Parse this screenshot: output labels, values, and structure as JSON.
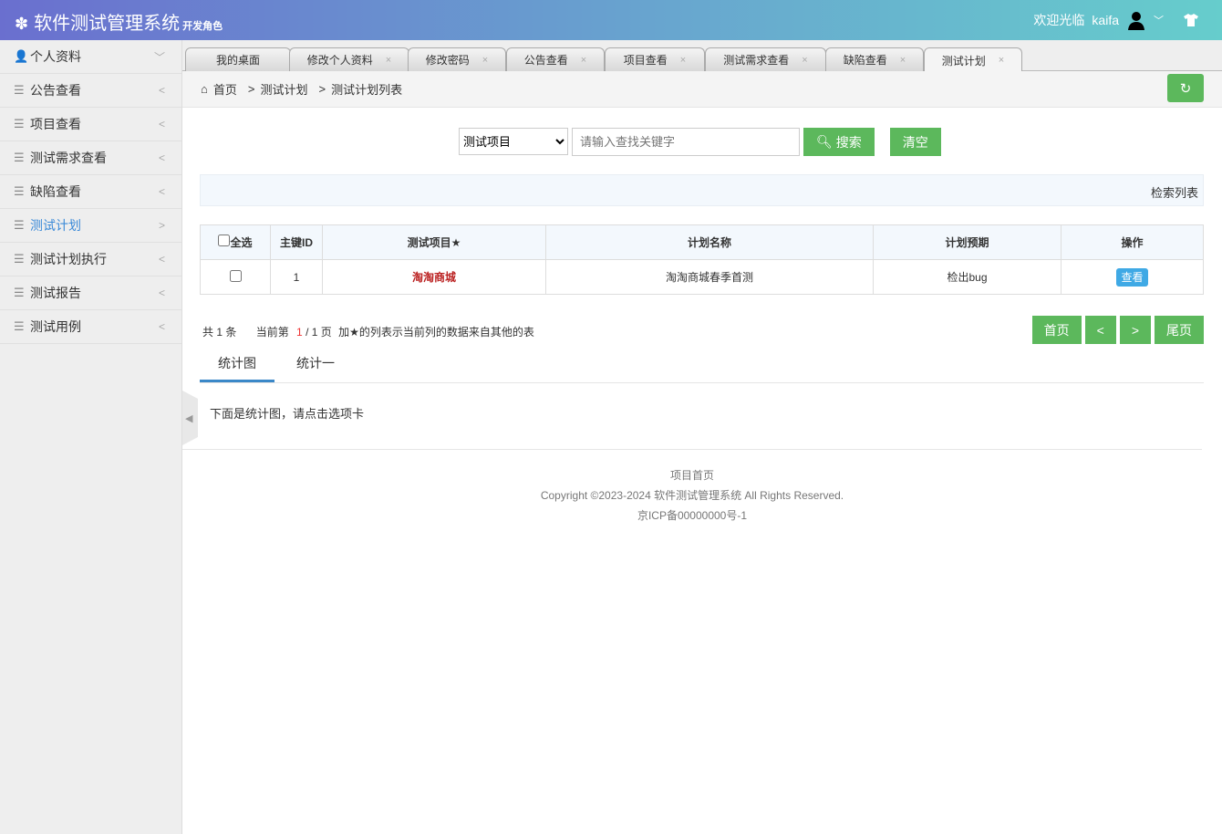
{
  "header": {
    "title": "软件测试管理系统",
    "role": "开发角色",
    "welcome": "欢迎光临",
    "user": "kaifa"
  },
  "sidebar": {
    "items": [
      {
        "label": "个人资料",
        "arrow": "﹀"
      },
      {
        "label": "公告查看",
        "arrow": "<"
      },
      {
        "label": "项目查看",
        "arrow": "<"
      },
      {
        "label": "测试需求查看",
        "arrow": "<"
      },
      {
        "label": "缺陷查看",
        "arrow": "<"
      },
      {
        "label": "测试计划",
        "arrow": ">"
      },
      {
        "label": "测试计划执行",
        "arrow": "<"
      },
      {
        "label": "测试报告",
        "arrow": "<"
      },
      {
        "label": "测试用例",
        "arrow": "<"
      }
    ]
  },
  "tabs": [
    {
      "label": "我的桌面"
    },
    {
      "label": "修改个人资料"
    },
    {
      "label": "修改密码"
    },
    {
      "label": "公告查看"
    },
    {
      "label": "项目查看"
    },
    {
      "label": "测试需求查看"
    },
    {
      "label": "缺陷查看"
    },
    {
      "label": "测试计划"
    }
  ],
  "tab_close": "×",
  "breadcrumb": {
    "home": "首页",
    "sep": ">",
    "level1": "测试计划",
    "level2": "测试计划列表"
  },
  "search": {
    "select": "测试项目",
    "placeholder": "请输入查找关键字",
    "search_label": "搜索",
    "clear_label": "清空"
  },
  "list_bar": "检索列表",
  "table": {
    "headers": [
      "全选",
      "主键ID",
      "测试项目★",
      "计划名称",
      "计划预期",
      "操作"
    ],
    "rows": [
      {
        "id": "1",
        "project": "淘淘商城",
        "name": "淘淘商城春季首测",
        "expect": "检出bug",
        "action": "查看"
      }
    ]
  },
  "pagination": {
    "total": "共 1 条",
    "current_prefix": "当前第",
    "current": "1",
    "of": "/ 1 页",
    "note": "加★的列表示当前列的数据来自其他的表",
    "first": "首页",
    "prev": "<",
    "next": ">",
    "last": "尾页"
  },
  "subtabs": [
    "统计图",
    "统计一"
  ],
  "note": "下面是统计图，请点击选项卡",
  "footer": {
    "line1": "项目首页",
    "line2": "Copyright ©2023-2024 软件测试管理系统 All Rights Reserved.",
    "line3": "京ICP备00000000号-1"
  }
}
